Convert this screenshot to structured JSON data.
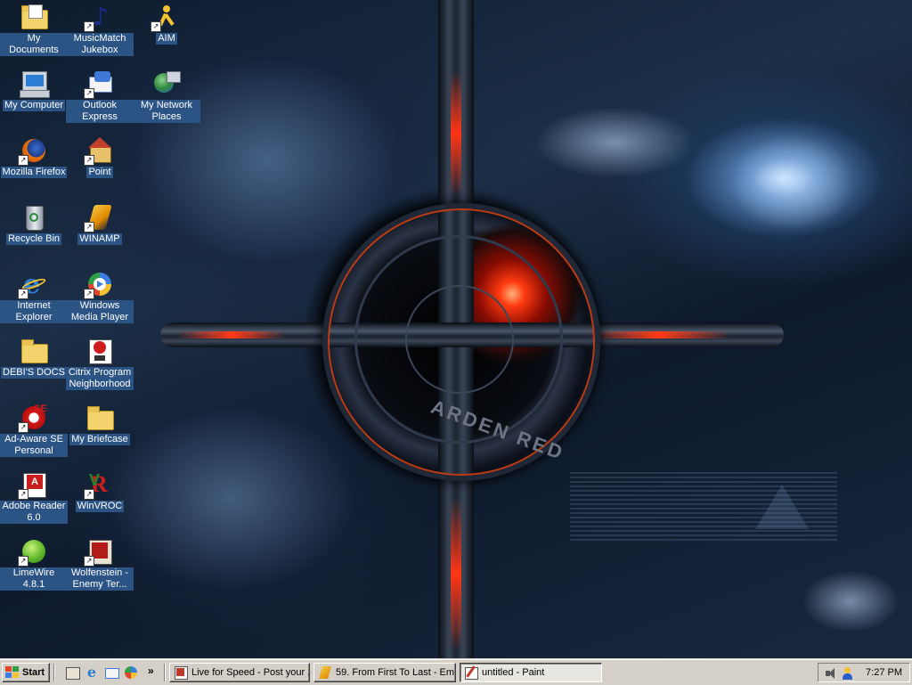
{
  "desktop_icons": [
    {
      "label": "My Documents",
      "icon": "my-documents-icon"
    },
    {
      "label": "MusicMatch Jukebox",
      "icon": "musicmatch-icon"
    },
    {
      "label": "AIM",
      "icon": "aim-icon"
    },
    {
      "label": "My Computer",
      "icon": "my-computer-icon"
    },
    {
      "label": "Outlook Express",
      "icon": "outlook-express-icon"
    },
    {
      "label": "My Network Places",
      "icon": "network-places-icon"
    },
    {
      "label": "Mozilla Firefox",
      "icon": "firefox-icon"
    },
    {
      "label": "Point",
      "icon": "point-icon"
    },
    {
      "label": "Recycle Bin",
      "icon": "recycle-bin-icon"
    },
    {
      "label": "WINAMP",
      "icon": "winamp-icon"
    },
    {
      "label": "Internet Explorer",
      "icon": "internet-explorer-icon"
    },
    {
      "label": "Windows Media Player",
      "icon": "media-player-icon"
    },
    {
      "label": "DEBI'S DOCS",
      "icon": "folder-icon"
    },
    {
      "label": "Citrix Program Neighborhood",
      "icon": "citrix-icon"
    },
    {
      "label": "Ad-Aware SE Personal",
      "icon": "ad-aware-icon"
    },
    {
      "label": "My Briefcase",
      "icon": "briefcase-icon"
    },
    {
      "label": "Adobe Reader 6.0",
      "icon": "adobe-reader-icon"
    },
    {
      "label": "WinVROC",
      "icon": "winvroc-icon"
    },
    {
      "label": "LimeWire 4.8.1",
      "icon": "limewire-icon"
    },
    {
      "label": "Wolfenstein - Enemy Ter...",
      "icon": "wolfenstein-icon"
    }
  ],
  "wallpaper": {
    "ring_text": "ARDEN RED"
  },
  "taskbar": {
    "start_label": "Start",
    "quick_launch_more": "»",
    "tasks": [
      {
        "label": "Live for Speed - Post your ...",
        "icon": "browser-icon",
        "active": false
      },
      {
        "label": "59. From First To Last - Em...",
        "icon": "winamp-icon",
        "active": false
      },
      {
        "label": "untitled - Paint",
        "icon": "paint-icon",
        "active": true
      }
    ],
    "clock": "7:27 PM"
  },
  "colors": {
    "taskbar": "#d4d0c8",
    "icon_label_bg": "#2b5384",
    "accent_red": "#ff3a15"
  }
}
